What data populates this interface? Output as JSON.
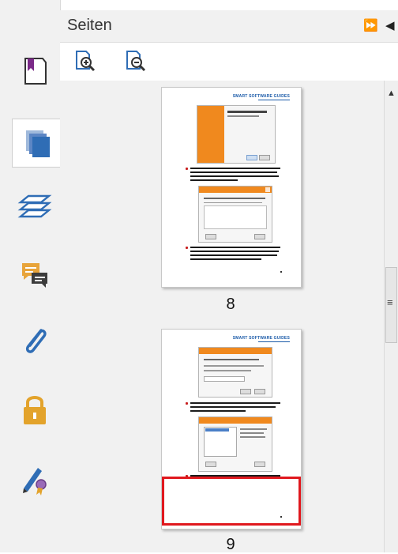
{
  "panel": {
    "title": "Seiten",
    "collapse_glyph": "⏩",
    "back_glyph": "◀"
  },
  "left_rail": {
    "items": [
      {
        "name": "bookmark-page-icon"
      },
      {
        "name": "pages-icon",
        "active": true
      },
      {
        "name": "layers-icon"
      },
      {
        "name": "comments-icon"
      },
      {
        "name": "attachments-icon"
      },
      {
        "name": "security-lock-icon"
      },
      {
        "name": "signature-icon"
      }
    ]
  },
  "toolbar": {
    "buttons": [
      {
        "name": "enlarge-thumbnails-icon"
      },
      {
        "name": "shrink-thumbnails-icon"
      }
    ]
  },
  "thumbnails": [
    {
      "page_number": "8",
      "header_text": "SMART SOFTWARE GUIDES"
    },
    {
      "page_number": "9",
      "header_text": "SMART SOFTWARE GUIDES",
      "selected_region": true
    }
  ],
  "scrollbar": {
    "up_glyph": "▲",
    "grip_glyph": "≡"
  },
  "colors": {
    "accent_orange": "#f0891e",
    "selection_red": "#e0181e",
    "rail_blue": "#2f6db5",
    "lock_gold": "#e3a32b"
  }
}
